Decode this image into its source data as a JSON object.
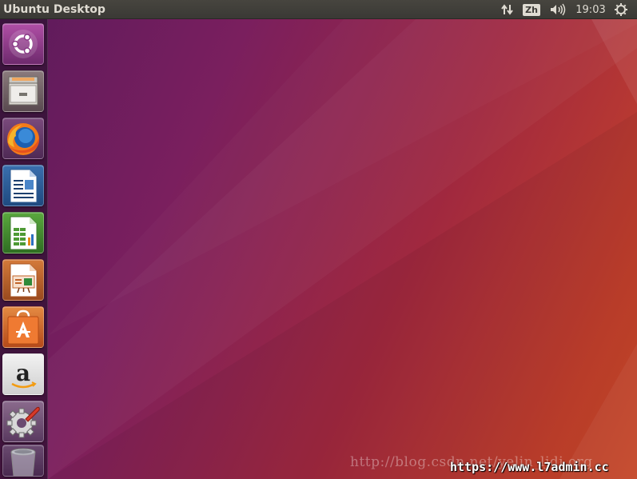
{
  "panel": {
    "title": "Ubuntu Desktop",
    "keyboard_layout": "Zh",
    "clock": "19:03"
  },
  "launcher": {
    "items": [
      {
        "name": "dash-home",
        "icon": "ubuntu-logo-icon"
      },
      {
        "name": "files",
        "icon": "file-cabinet-icon"
      },
      {
        "name": "firefox",
        "icon": "firefox-icon"
      },
      {
        "name": "libreoffice-writer",
        "icon": "writer-document-icon"
      },
      {
        "name": "libreoffice-calc",
        "icon": "calc-spreadsheet-icon"
      },
      {
        "name": "libreoffice-impress",
        "icon": "impress-presentation-icon"
      },
      {
        "name": "ubuntu-software",
        "icon": "software-bag-icon"
      },
      {
        "name": "amazon",
        "icon": "amazon-icon"
      },
      {
        "name": "system-settings",
        "icon": "settings-gear-wrench-icon"
      },
      {
        "name": "trash",
        "icon": "trash-icon"
      }
    ]
  },
  "colors": {
    "panel_bg": "#3c3b37",
    "panel_text": "#dfdbd2",
    "launcher_bg": "#321234",
    "wallpaper_left": "#5a1a5c",
    "wallpaper_right": "#cf4a2a"
  },
  "watermark": {
    "url_text": "http://blog.csdn.net/yelin_ljdj.org",
    "brand_text": "https://www.l7admin.cc"
  }
}
